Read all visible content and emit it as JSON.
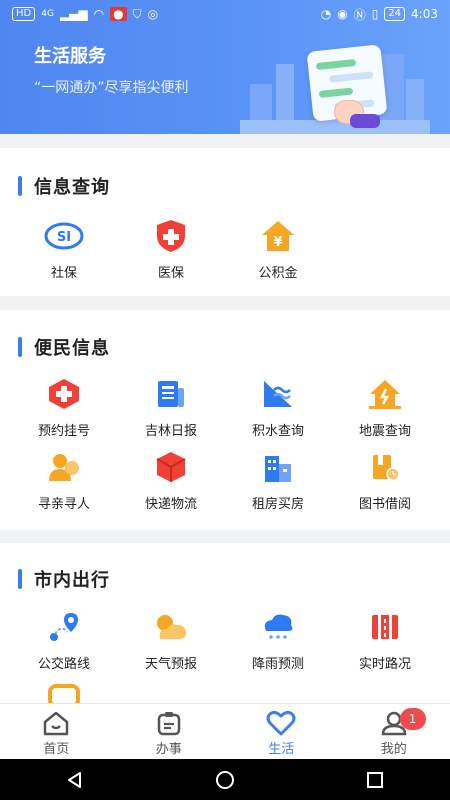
{
  "statusbar": {
    "left_icons": [
      "HD",
      "4G",
      "signal",
      "wifi",
      "record",
      "shield",
      "globe"
    ],
    "battery": "24",
    "time": "4:03"
  },
  "banner": {
    "title": "生活服务",
    "subtitle": "“一网通办”尽享指尖便利"
  },
  "sections": [
    {
      "title": "信息查询",
      "items": [
        {
          "label": "社保",
          "icon": "social-security-icon"
        },
        {
          "label": "医保",
          "icon": "medical-insurance-icon"
        },
        {
          "label": "公积金",
          "icon": "housing-fund-icon"
        }
      ]
    },
    {
      "title": "便民信息",
      "items": [
        {
          "label": "预约挂号",
          "icon": "hospital-appointment-icon"
        },
        {
          "label": "吉林日报",
          "icon": "newspaper-icon"
        },
        {
          "label": "积水查询",
          "icon": "waterlogging-icon"
        },
        {
          "label": "地震查询",
          "icon": "earthquake-icon"
        },
        {
          "label": "寻亲寻人",
          "icon": "person-search-icon"
        },
        {
          "label": "快递物流",
          "icon": "package-icon"
        },
        {
          "label": "租房买房",
          "icon": "buildings-icon"
        },
        {
          "label": "图书借阅",
          "icon": "book-icon"
        }
      ]
    },
    {
      "title": "市内出行",
      "items": [
        {
          "label": "公交路线",
          "icon": "route-icon"
        },
        {
          "label": "天气预报",
          "icon": "weather-icon"
        },
        {
          "label": "降雨预测",
          "icon": "rain-cloud-icon"
        },
        {
          "label": "实时路况",
          "icon": "traffic-icon"
        }
      ]
    }
  ],
  "tabs": [
    {
      "label": "首页",
      "icon": "home-icon"
    },
    {
      "label": "办事",
      "icon": "briefcase-icon"
    },
    {
      "label": "生活",
      "icon": "heart-icon"
    },
    {
      "label": "我的",
      "icon": "profile-icon",
      "badge": "1"
    }
  ],
  "active_tab": "生活",
  "colors": {
    "accent": "#3b7df2",
    "banner": "#5a93f6",
    "badge": "#ef4b4b"
  }
}
